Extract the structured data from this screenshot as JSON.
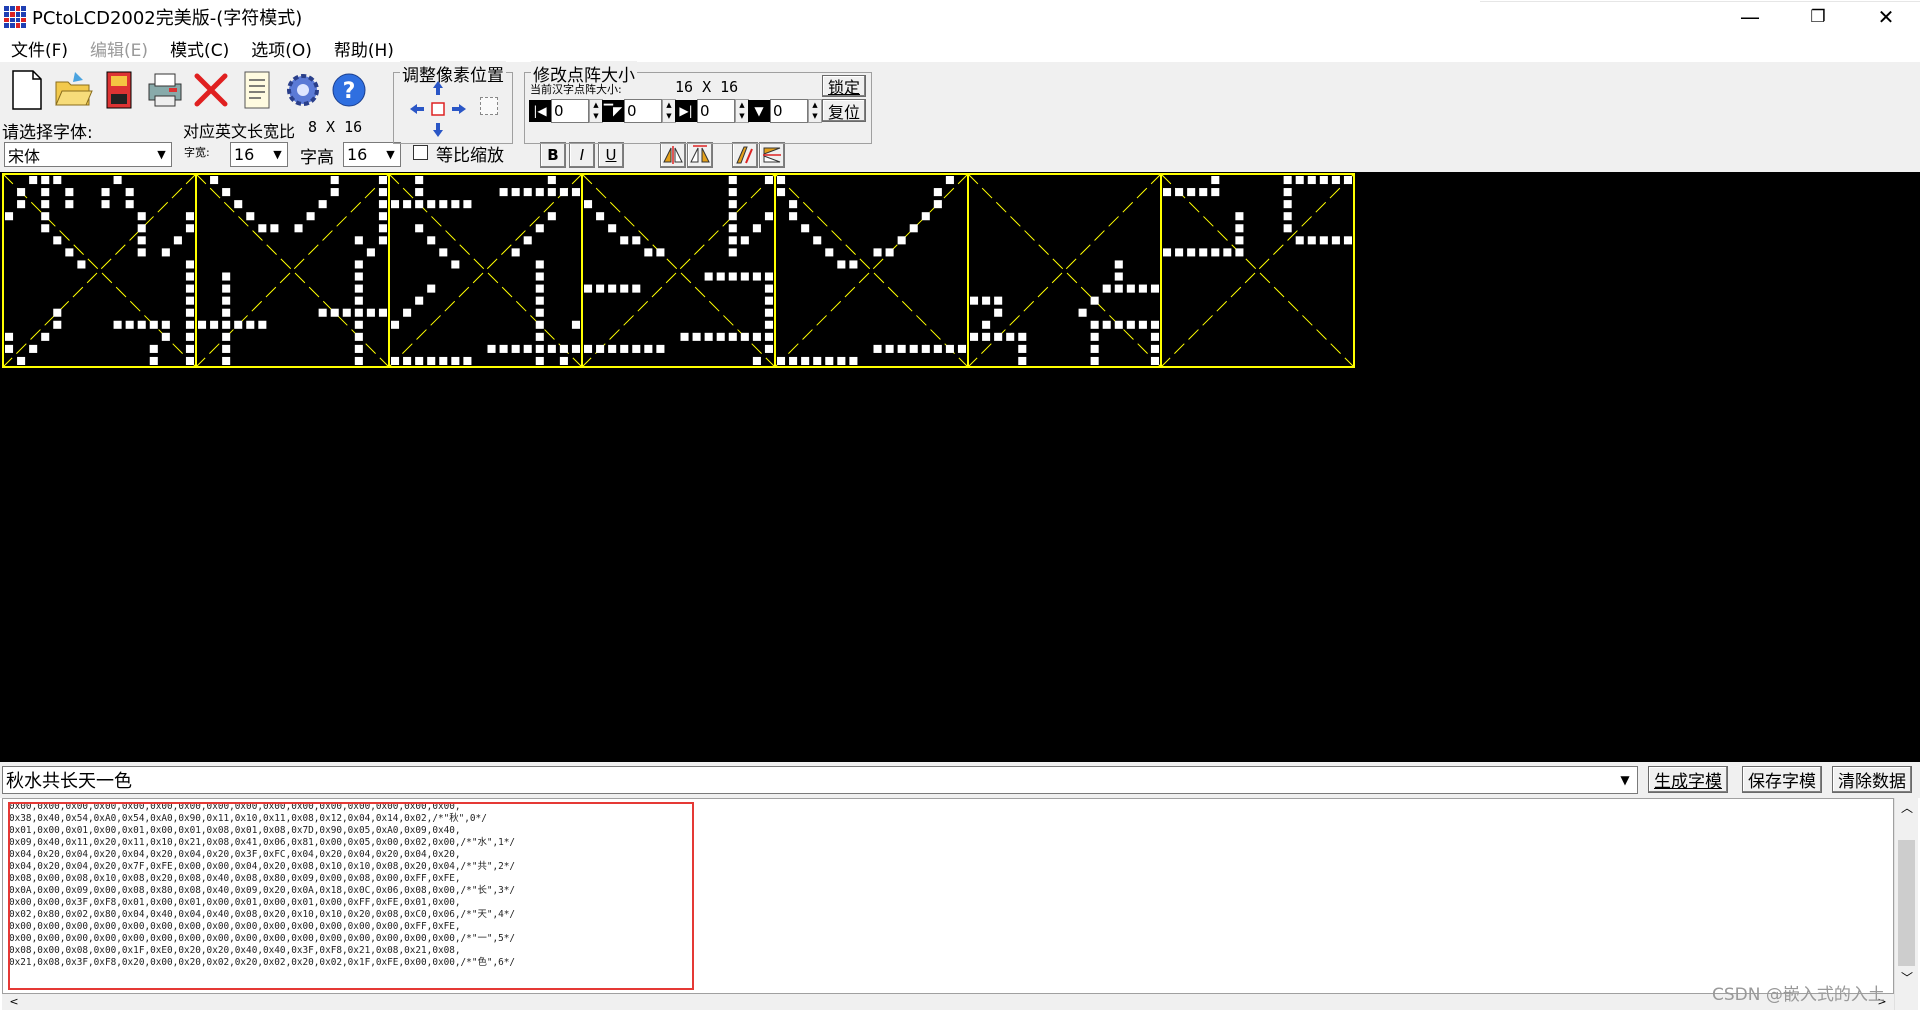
{
  "window": {
    "title": "PCtoLCD2002完美版-(字符模式)",
    "minimize": "—",
    "restore": "❐",
    "close": "✕"
  },
  "menu": [
    {
      "label": "文件(F)",
      "enabled": true
    },
    {
      "label": "编辑(E)",
      "enabled": false
    },
    {
      "label": "模式(C)",
      "enabled": true
    },
    {
      "label": "选项(O)",
      "enabled": true
    },
    {
      "label": "帮助(H)",
      "enabled": true
    }
  ],
  "toolbar": {
    "icons": [
      "new-file-icon",
      "open-folder-icon",
      "save-disk-icon",
      "print-icon",
      "delete-x-icon",
      "notepad-icon",
      "settings-gear-icon",
      "help-icon"
    ],
    "font_label": "请选择字体:",
    "font_value": "宋体",
    "ratio_label": "对应英文长宽比",
    "ratio_value": "8 X 16",
    "width_label": "字宽:",
    "width_value": "16",
    "height_label": "字高",
    "height_value": "16",
    "proportional_label": "等比缩放",
    "bold": "B",
    "italic": "I",
    "underline": "U"
  },
  "pixel_position_group": {
    "title": "调整像素位置"
  },
  "matrix_group": {
    "title": "修改点阵大小",
    "current_label": "当前汉字点阵大小:",
    "current_value": "16 X 16",
    "lock_button": "锁定",
    "reset_button": "复位",
    "spin_values": [
      "0",
      "0",
      "0",
      "0"
    ]
  },
  "preview": {
    "characters": [
      "秋",
      "水",
      "共",
      "长",
      "天",
      "一",
      "色"
    ],
    "border_color": "#ffff00",
    "glyph_color": "#ffffff"
  },
  "input_text": "秋水共长天一色",
  "buttons": {
    "generate": "生成字模",
    "save": "保存字模",
    "clear": "清除数据"
  },
  "output_lines": [
    "0x00,0x00,0x00,0x00,0x00,0x00,0x00,0x00,0x00,0x00,0x00,0x00,0x00,0x00,0x00,0x00,",
    "0x38,0x40,0x54,0xA0,0x54,0xA0,0x90,0x11,0x10,0x11,0x08,0x12,0x04,0x14,0x02,/*\"秋\",0*/",
    "0x01,0x00,0x01,0x00,0x01,0x00,0x01,0x08,0x01,0x08,0x7D,0x90,0x05,0xA0,0x09,0x40,",
    "0x09,0x40,0x11,0x20,0x11,0x10,0x21,0x08,0x41,0x06,0x81,0x00,0x05,0x00,0x02,0x00,/*\"水\",1*/",
    "0x04,0x20,0x04,0x20,0x04,0x20,0x04,0x20,0x3F,0xFC,0x04,0x20,0x04,0x20,0x04,0x20,",
    "0x04,0x20,0x04,0x20,0x7F,0xFE,0x00,0x00,0x04,0x20,0x08,0x10,0x10,0x08,0x20,0x04,/*\"共\",2*/",
    "0x08,0x00,0x08,0x10,0x08,0x20,0x08,0x40,0x08,0x80,0x09,0x00,0x08,0x00,0xFF,0xFE,",
    "0x0A,0x00,0x09,0x00,0x08,0x80,0x08,0x40,0x09,0x20,0x0A,0x18,0x0C,0x06,0x08,0x00,/*\"长\",3*/",
    "0x00,0x00,0x3F,0xF8,0x01,0x00,0x01,0x00,0x01,0x00,0x01,0x00,0xFF,0xFE,0x01,0x00,",
    "0x02,0x80,0x02,0x80,0x04,0x40,0x04,0x40,0x08,0x20,0x10,0x10,0x20,0x08,0xC0,0x06,/*\"天\",4*/",
    "0x00,0x00,0x00,0x00,0x00,0x00,0x00,0x00,0x00,0x00,0x00,0x00,0x00,0x00,0xFF,0xFE,",
    "0x00,0x00,0x00,0x00,0x00,0x00,0x00,0x00,0x00,0x00,0x00,0x00,0x00,0x00,0x00,0x00,/*\"一\",5*/",
    "0x08,0x00,0x08,0x00,0x1F,0xE0,0x20,0x20,0x40,0x40,0x3F,0xF8,0x21,0x08,0x21,0x08,",
    "0x21,0x08,0x3F,0xF8,0x20,0x00,0x20,0x02,0x20,0x02,0x20,0x02,0x1F,0xFE,0x00,0x00,/*\"色\",6*/"
  ],
  "watermark": "CSDN @嵌入式的入土"
}
